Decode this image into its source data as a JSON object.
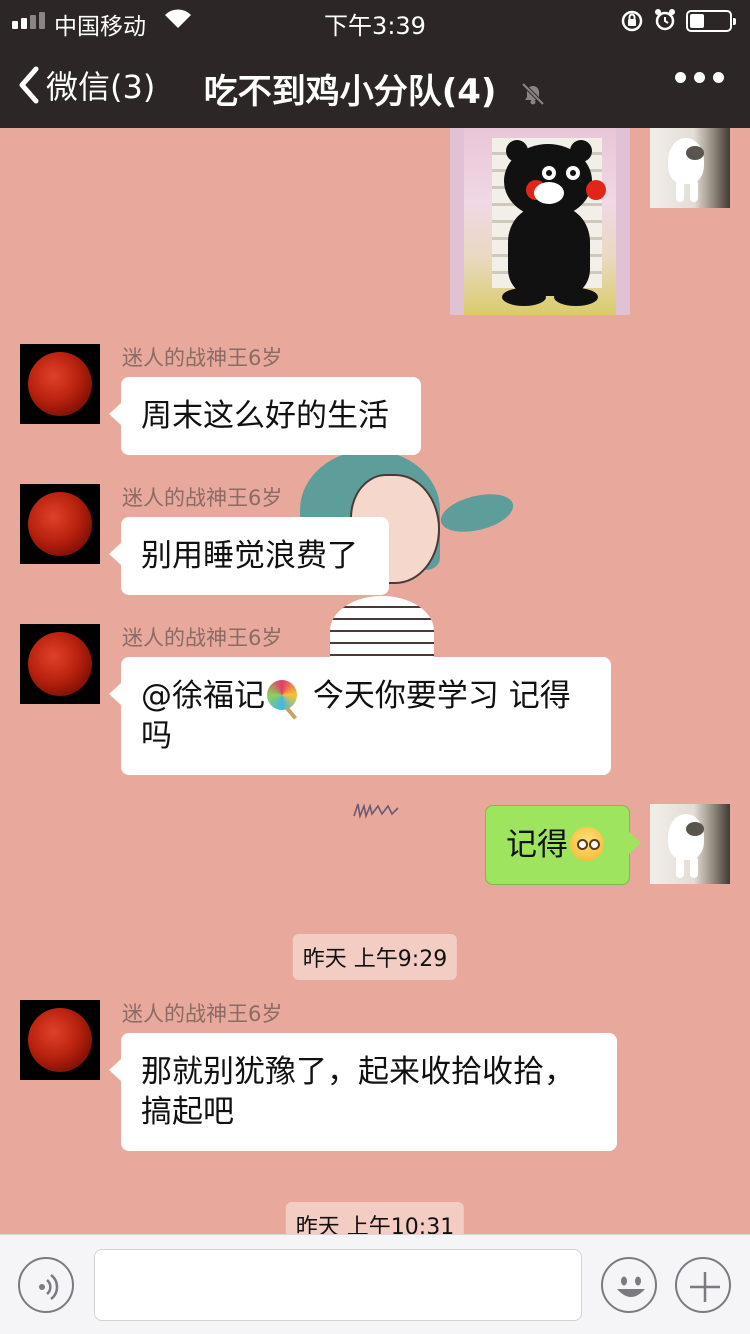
{
  "status_bar": {
    "carrier": "中国移动",
    "time": "下午3:39"
  },
  "nav": {
    "back_label": "微信(3)",
    "title": "吃不到鸡小分队(4)"
  },
  "messages": [
    {
      "sender": "迷人的战神王6岁",
      "text": "周末这么好的生活"
    },
    {
      "sender": "迷人的战神王6岁",
      "text": "别用睡觉浪费了"
    },
    {
      "sender": "迷人的战神王6岁",
      "text_before": "@徐福记",
      "text_after": " 今天你要学习 记得吗"
    },
    {
      "sender": "me",
      "text": "记得"
    },
    {
      "sender": "迷人的战神王6岁",
      "text": "那就别犹豫了，起来收拾收拾，搞起吧"
    }
  ],
  "timestamps": [
    "昨天 上午9:29",
    "昨天 上午10:31"
  ],
  "icons": {
    "back": "chevron-left-icon",
    "mute": "bell-off-icon",
    "more": "more-dots-icon",
    "voice": "voice-icon",
    "emoji": "emoji-icon",
    "plus": "plus-icon"
  }
}
